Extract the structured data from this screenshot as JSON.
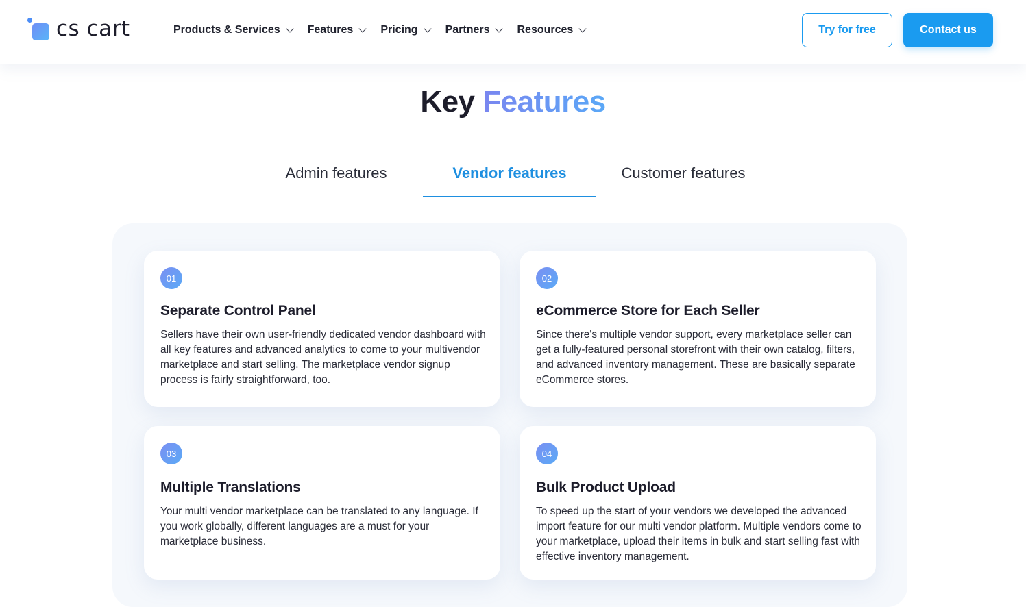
{
  "header": {
    "logo_text": "cs cart",
    "nav": [
      {
        "label": "Products & Services"
      },
      {
        "label": "Features"
      },
      {
        "label": "Pricing"
      },
      {
        "label": "Partners"
      },
      {
        "label": "Resources"
      }
    ],
    "try_label": "Try for free",
    "contact_label": "Contact us"
  },
  "section": {
    "title_part1": "Key",
    "title_part2": "Features"
  },
  "tabs": [
    {
      "label": "Admin features",
      "active": false
    },
    {
      "label": "Vendor features",
      "active": true
    },
    {
      "label": "Customer features",
      "active": false
    }
  ],
  "cards": [
    {
      "number": "01",
      "title": "Separate Control Panel",
      "text": "Sellers have their own user-friendly dedicated vendor dashboard with all key features and advanced analytics to come to your multivendor marketplace and start selling. The marketplace vendor signup process is fairly straightforward, too."
    },
    {
      "number": "02",
      "title": "eCommerce Store for Each Seller",
      "text": "Since there's multiple vendor support, every marketplace seller can get a fully-featured personal storefront with their own catalog, filters, and advanced inventory management. These are basically separate eCommerce stores."
    },
    {
      "number": "03",
      "title": "Multiple Translations",
      "text": "Your multi vendor marketplace can be translated to any language. If you work globally, different languages are a must for your marketplace business."
    },
    {
      "number": "04",
      "title": "Bulk Product Upload",
      "text": "To speed up the start of your vendors we developed the advanced import feature for our multi vendor platform. Multiple vendors come to your marketplace, upload their items in bulk and start selling fast with effective inventory management."
    }
  ],
  "colors": {
    "accent": "#1a9bf0",
    "active_tab": "#1e8fe0",
    "title_gradient_start": "#7a86f0",
    "title_gradient_end": "#5aa8f7",
    "panel_bg": "#f5f8fc"
  },
  "icons": {
    "nav_dropdown": "chevron-down-icon"
  }
}
